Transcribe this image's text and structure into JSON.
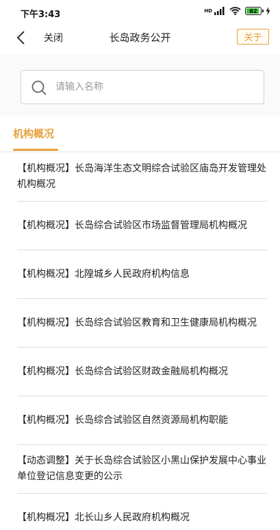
{
  "status_bar": {
    "time": "下午3:43",
    "network": "HD",
    "battery": "82",
    "battery_level": 0.82
  },
  "nav": {
    "back_icon": "chevron-left-icon",
    "close_label": "关闭",
    "title": "长岛政务公开",
    "about_label": "关于"
  },
  "search": {
    "placeholder": "请输入名称",
    "value": "",
    "icon": "search-icon"
  },
  "tabs": [
    {
      "label": "机构概况",
      "active": true
    }
  ],
  "list": {
    "items": [
      {
        "text": "【机构概况】长岛海洋生态文明综合试验区庙岛开发管理处机构概况"
      },
      {
        "text": "【机构概况】长岛综合试验区市场监督管理局机构概况"
      },
      {
        "text": "【机构概况】北隍城乡人民政府机构信息"
      },
      {
        "text": "【机构概况】长岛综合试验区教育和卫生健康局机构概况"
      },
      {
        "text": "【机构概况】长岛综合试验区财政金融局机构概况"
      },
      {
        "text": "【机构概况】长岛综合试验区自然资源局机构职能"
      },
      {
        "text": "【动态调整】关于长岛综合试验区小黑山保护发展中心事业单位登记信息变更的公示"
      },
      {
        "text": "【机构概况】北长山乡人民政府机构概况"
      }
    ]
  },
  "colors": {
    "accent": "#e6a23c",
    "divider": "#dcdcdc",
    "battery_green": "#3bbf3b"
  }
}
